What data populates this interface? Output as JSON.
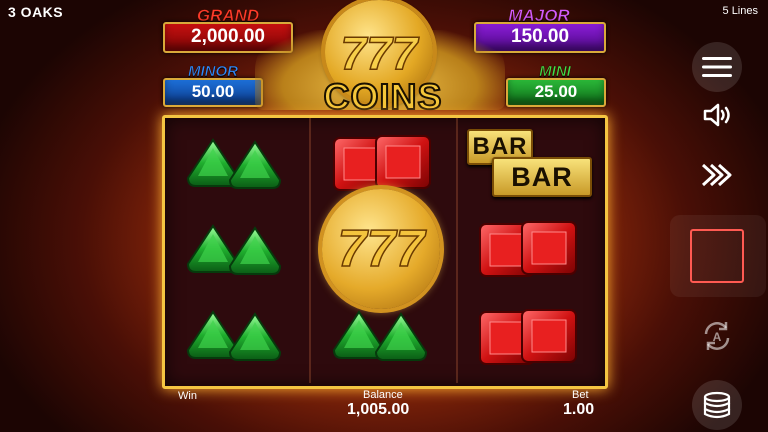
{
  "brand": "3 OAKS",
  "lines": "5 Lines",
  "jackpots": {
    "grand": {
      "label": "GRAND",
      "value": "2,000.00"
    },
    "major": {
      "label": "MAJOR",
      "value": "150.00"
    },
    "minor": {
      "label": "MINOR",
      "value": "50.00"
    },
    "mini": {
      "label": "MINI",
      "value": "25.00"
    }
  },
  "logo": {
    "coin_text": "777",
    "title": "COINS"
  },
  "reels": {
    "bar_text": "BAR",
    "coin_text": "777",
    "symbols": [
      [
        "green-gem",
        "green-gem",
        "green-gem"
      ],
      [
        "red-gem",
        "coin-777",
        "green-gem"
      ],
      [
        "bar-bar",
        "red-gem",
        "red-gem"
      ]
    ]
  },
  "footer": {
    "win_label": "Win",
    "balance_label": "Balance",
    "balance_value": "1,005.00",
    "bet_label": "Bet",
    "bet_value": "1.00"
  },
  "controls": [
    "menu-icon",
    "sound-icon",
    "turbo-icon",
    "spin-stop-icon",
    "autoplay-icon",
    "coins-icon"
  ],
  "colors": {
    "frame": "#f4c542",
    "spin_stop": "#ff5a52"
  }
}
